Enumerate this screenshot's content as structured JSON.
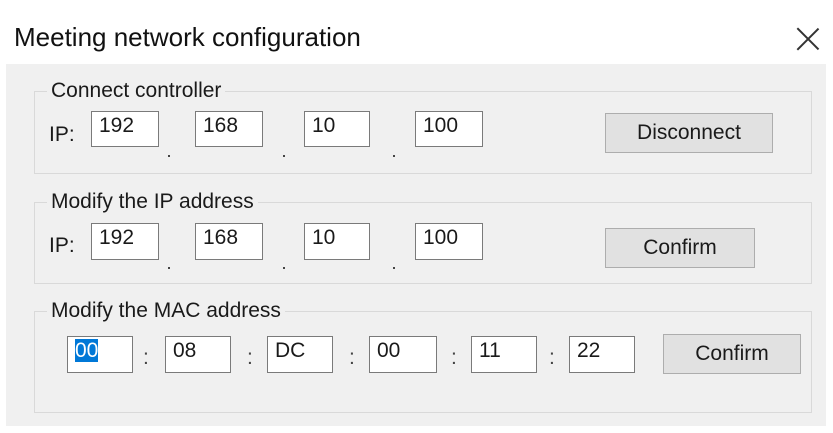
{
  "window": {
    "title": "Meeting network configuration"
  },
  "connect_controller": {
    "legend": "Connect controller",
    "ip_label": "IP:",
    "ip": [
      "192",
      "168",
      "10",
      "100"
    ],
    "button": "Disconnect"
  },
  "modify_ip": {
    "legend": "Modify the IP address",
    "ip_label": "IP:",
    "ip": [
      "192",
      "168",
      "10",
      "100"
    ],
    "button": "Confirm"
  },
  "modify_mac": {
    "legend": "Modify the MAC address",
    "separator": ":",
    "mac": [
      "00",
      "08",
      "DC",
      "00",
      "11",
      "22"
    ],
    "button": "Confirm"
  },
  "icons": {
    "close": "close-icon"
  }
}
